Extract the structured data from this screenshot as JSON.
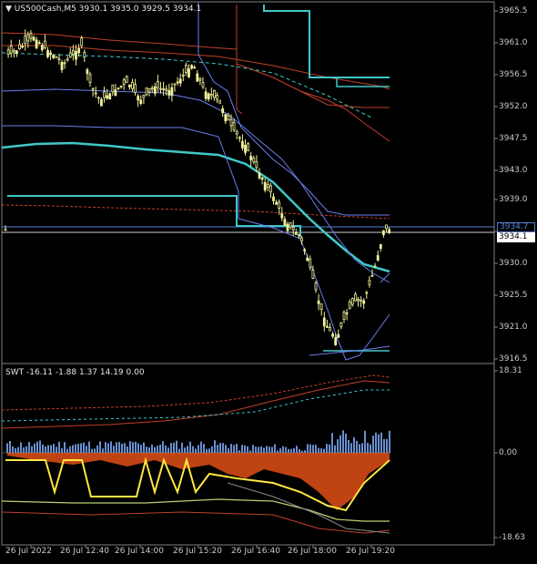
{
  "chart": {
    "symbol_line": "US500Cash,M5  3930.1 3935.0 3929.5 3934.1",
    "price_labels": [
      "3965.5",
      "3961.0",
      "3956.5",
      "3952.0",
      "3947.5",
      "3943.0",
      "3939.0",
      "3930.0",
      "3925.5",
      "3921.0",
      "3916.5"
    ],
    "current_price": "3934.1",
    "ask_price": "3934.7",
    "time_labels": [
      "26 Jul 2022",
      "26 Jul 12:40",
      "26 Jul 14:00",
      "26 Jul 15:20",
      "26 Jul 16:40",
      "26 Jul 18:00",
      "26 Jul 19:20"
    ]
  },
  "indicator": {
    "title": "SWT -16.11 -1.88 1.37 14.19 0.00",
    "scale_labels": [
      "18.31",
      "0.00",
      "-18.63"
    ]
  },
  "colors": {
    "background": "#000000",
    "bull_candle": "#f0f09a",
    "teal_line": "#3fc8c8",
    "blue_band": "#6a7ff0",
    "red_band": "#c0402a",
    "histogram_blue": "#6a8fd0",
    "histogram_orange": "#ff5a1a",
    "yellow_line": "#ffe840"
  },
  "chart_data": {
    "type": "line",
    "title": "US500Cash,M5",
    "ylim": [
      3916.5,
      3965.5
    ],
    "x": [
      "26 Jul 2022",
      "26 Jul 12:40",
      "26 Jul 14:00",
      "26 Jul 15:20",
      "26 Jul 16:40",
      "26 Jul 18:00",
      "26 Jul 19:20"
    ],
    "series": [
      {
        "name": "US500Cash,M5",
        "values": [
          3958.5,
          3957.0,
          3956.0,
          3950.0,
          3939.0,
          3921.0,
          3934.1
        ]
      }
    ]
  }
}
